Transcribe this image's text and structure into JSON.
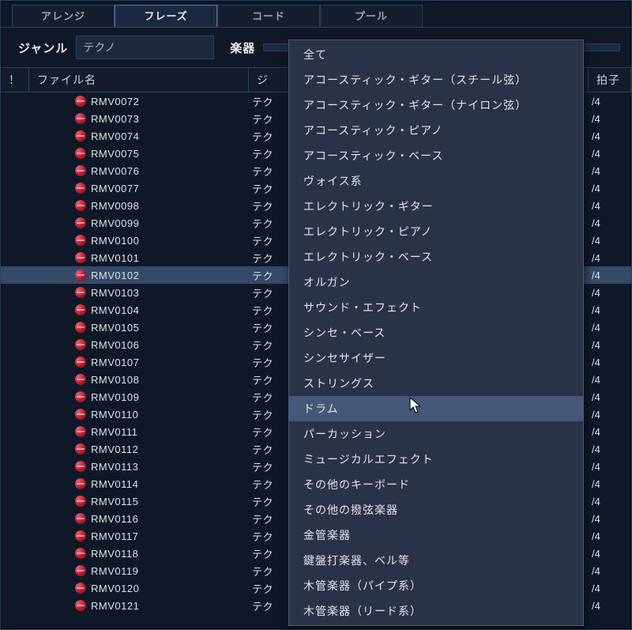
{
  "tabs": [
    {
      "label": "アレンジ",
      "active": false
    },
    {
      "label": "フレーズ",
      "active": true
    },
    {
      "label": "コード",
      "active": false
    },
    {
      "label": "プール",
      "active": false
    }
  ],
  "filters": {
    "genre_label": "ジャンル",
    "genre_value": "テクノ",
    "instrument_label": "楽器",
    "instrument_value": ""
  },
  "columns": {
    "bang": "！",
    "filename": "ファイル名",
    "genre": "ジ",
    "beat": "拍子"
  },
  "rows": [
    {
      "file": "RMV0072",
      "genre": "テク",
      "beat": "/4",
      "selected": false
    },
    {
      "file": "RMV0073",
      "genre": "テク",
      "beat": "/4",
      "selected": false
    },
    {
      "file": "RMV0074",
      "genre": "テク",
      "beat": "/4",
      "selected": false
    },
    {
      "file": "RMV0075",
      "genre": "テク",
      "beat": "/4",
      "selected": false
    },
    {
      "file": "RMV0076",
      "genre": "テク",
      "beat": "/4",
      "selected": false
    },
    {
      "file": "RMV0077",
      "genre": "テク",
      "beat": "/4",
      "selected": false
    },
    {
      "file": "RMV0098",
      "genre": "テク",
      "beat": "/4",
      "selected": false
    },
    {
      "file": "RMV0099",
      "genre": "テク",
      "beat": "/4",
      "selected": false
    },
    {
      "file": "RMV0100",
      "genre": "テク",
      "beat": "/4",
      "selected": false
    },
    {
      "file": "RMV0101",
      "genre": "テク",
      "beat": "/4",
      "selected": false
    },
    {
      "file": "RMV0102",
      "genre": "テク",
      "beat": "/4",
      "selected": true
    },
    {
      "file": "RMV0103",
      "genre": "テク",
      "beat": "/4",
      "selected": false
    },
    {
      "file": "RMV0104",
      "genre": "テク",
      "beat": "/4",
      "selected": false
    },
    {
      "file": "RMV0105",
      "genre": "テク",
      "beat": "/4",
      "selected": false
    },
    {
      "file": "RMV0106",
      "genre": "テク",
      "beat": "/4",
      "selected": false
    },
    {
      "file": "RMV0107",
      "genre": "テク",
      "beat": "/4",
      "selected": false
    },
    {
      "file": "RMV0108",
      "genre": "テク",
      "beat": "/4",
      "selected": false
    },
    {
      "file": "RMV0109",
      "genre": "テク",
      "beat": "/4",
      "selected": false
    },
    {
      "file": "RMV0110",
      "genre": "テク",
      "beat": "/4",
      "selected": false
    },
    {
      "file": "RMV0111",
      "genre": "テク",
      "beat": "/4",
      "selected": false
    },
    {
      "file": "RMV0112",
      "genre": "テク",
      "beat": "/4",
      "selected": false
    },
    {
      "file": "RMV0113",
      "genre": "テク",
      "beat": "/4",
      "selected": false
    },
    {
      "file": "RMV0114",
      "genre": "テク",
      "beat": "/4",
      "selected": false
    },
    {
      "file": "RMV0115",
      "genre": "テク",
      "beat": "/4",
      "selected": false
    },
    {
      "file": "RMV0116",
      "genre": "テク",
      "beat": "/4",
      "selected": false
    },
    {
      "file": "RMV0117",
      "genre": "テク",
      "beat": "/4",
      "selected": false
    },
    {
      "file": "RMV0118",
      "genre": "テク",
      "beat": "/4",
      "selected": false
    },
    {
      "file": "RMV0119",
      "genre": "テク",
      "beat": "/4",
      "selected": false
    },
    {
      "file": "RMV0120",
      "genre": "テク",
      "beat": "/4",
      "selected": false
    },
    {
      "file": "RMV0121",
      "genre": "テク",
      "beat": "/4",
      "selected": false
    }
  ],
  "dropdown": {
    "items": [
      {
        "label": "全て",
        "highlight": false
      },
      {
        "label": "アコースティック・ギター（スチール弦）",
        "highlight": false
      },
      {
        "label": "アコースティック・ギター（ナイロン弦）",
        "highlight": false
      },
      {
        "label": "アコースティック・ピアノ",
        "highlight": false
      },
      {
        "label": "アコースティック・ベース",
        "highlight": false
      },
      {
        "label": "ヴォイス系",
        "highlight": false
      },
      {
        "label": "エレクトリック・ギター",
        "highlight": false
      },
      {
        "label": "エレクトリック・ピアノ",
        "highlight": false
      },
      {
        "label": "エレクトリック・ベース",
        "highlight": false
      },
      {
        "label": "オルガン",
        "highlight": false
      },
      {
        "label": "サウンド・エフェクト",
        "highlight": false
      },
      {
        "label": "シンセ・ベース",
        "highlight": false
      },
      {
        "label": "シンセサイザー",
        "highlight": false
      },
      {
        "label": "ストリングス",
        "highlight": false
      },
      {
        "label": "ドラム",
        "highlight": true
      },
      {
        "label": "パーカッション",
        "highlight": false
      },
      {
        "label": "ミュージカルエフェクト",
        "highlight": false
      },
      {
        "label": "その他のキーボード",
        "highlight": false
      },
      {
        "label": "その他の撥弦楽器",
        "highlight": false
      },
      {
        "label": "金管楽器",
        "highlight": false
      },
      {
        "label": "鍵盤打楽器、ベル等",
        "highlight": false
      },
      {
        "label": "木管楽器（パイプ系）",
        "highlight": false
      },
      {
        "label": "木管楽器（リード系）",
        "highlight": false
      }
    ]
  }
}
